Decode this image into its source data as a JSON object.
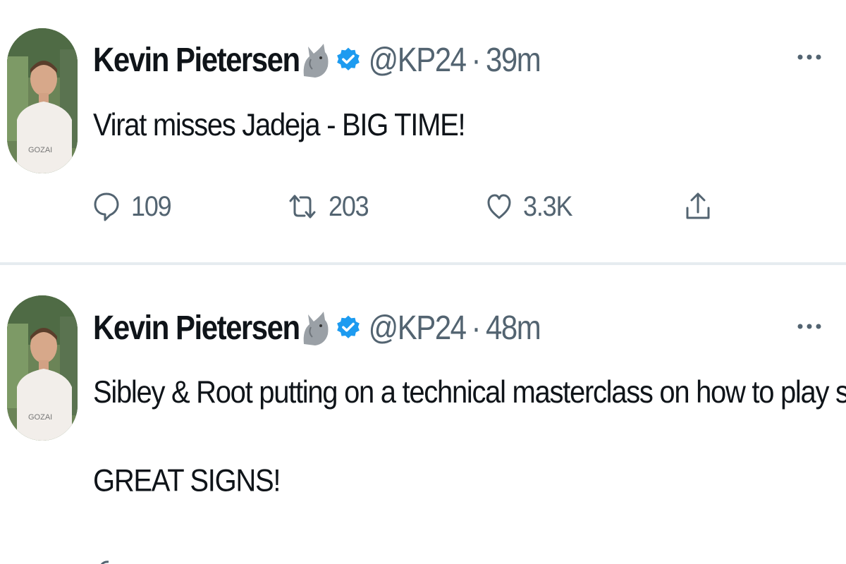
{
  "tweets": [
    {
      "author_name": "Kevin Pietersen",
      "name_emoji_icon": "rhino-icon",
      "verified_icon": "verified-badge-icon",
      "handle": "@KP24",
      "separator": "·",
      "time": "39m",
      "text": "Virat misses Jadeja - BIG TIME!",
      "actions": {
        "reply_count": "109",
        "retweet_count": "203",
        "like_count": "3.3K",
        "share_icon": "share-icon"
      }
    },
    {
      "author_name": "Kevin Pietersen",
      "name_emoji_icon": "rhino-icon",
      "verified_icon": "verified-badge-icon",
      "handle": "@KP24",
      "separator": "·",
      "time": "48m",
      "text": "Sibley & Root putting on a technical masterclass on how to play spin.\n\nGREAT SIGNS!"
    }
  ],
  "colors": {
    "secondary_text": "#536471",
    "verified_blue": "#1d9bf0",
    "divider": "#e6ecf0"
  }
}
